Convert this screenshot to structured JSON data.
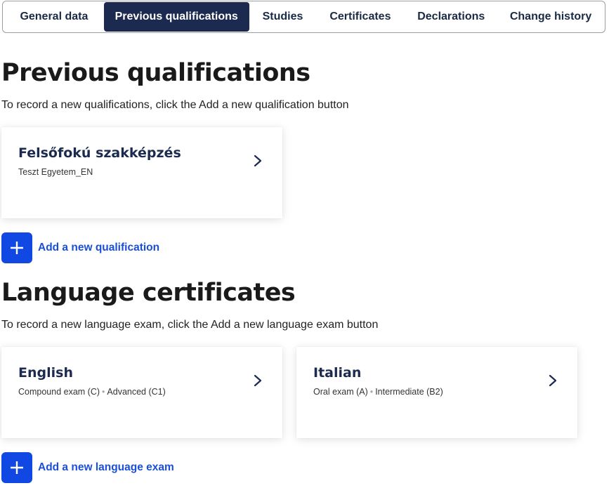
{
  "tabs": [
    {
      "label": "General data",
      "active": false
    },
    {
      "label": "Previous qualifications",
      "active": true
    },
    {
      "label": "Studies",
      "active": false
    },
    {
      "label": "Certificates",
      "active": false
    },
    {
      "label": "Declarations",
      "active": false
    },
    {
      "label": "Change history",
      "active": false
    }
  ],
  "qualifications": {
    "heading": "Previous qualifications",
    "hint": "To record a new qualifications, click the Add a new qualification button",
    "items": [
      {
        "title": "Felsőfokú szakképzés",
        "subtitle": "Teszt Egyetem_EN"
      }
    ],
    "add_label": "Add a new qualification"
  },
  "languages": {
    "heading": "Language certificates",
    "hint": "To record a new language exam, click the Add a new language exam button",
    "items": [
      {
        "title": "English",
        "exam": "Compound exam (C)",
        "level": "Advanced (C1)"
      },
      {
        "title": "Italian",
        "exam": "Oral exam (A)",
        "level": "Intermediate (B2)"
      }
    ],
    "add_label": "Add a new language exam"
  },
  "icons": {
    "chevron": "chevron-right-icon",
    "plus": "plus-icon"
  },
  "colors": {
    "active_tab_bg": "#1b2a4e",
    "primary_button": "#1148e4",
    "link": "#1a4fd6",
    "card_title": "#1b2a4e"
  }
}
